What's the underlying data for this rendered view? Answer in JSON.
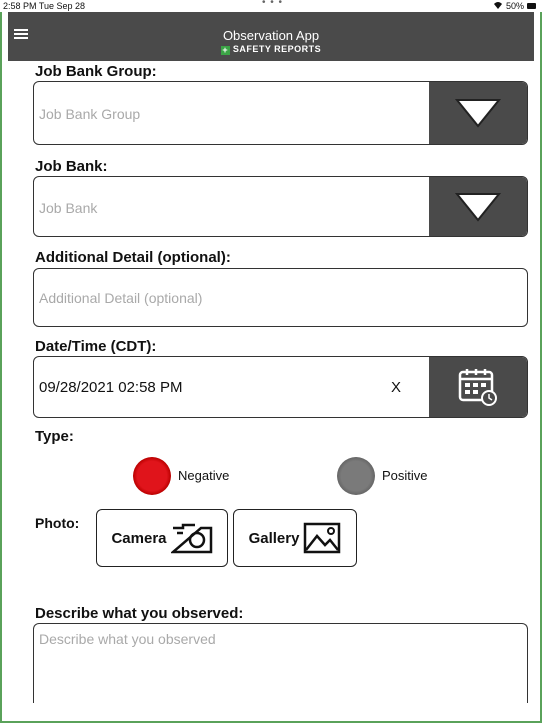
{
  "status": {
    "time": "2:58 PM  Tue Sep 28",
    "dots": "• • •",
    "battery": "50%"
  },
  "header": {
    "title": "Observation App",
    "brand": "SAFETY REPORTS"
  },
  "form": {
    "job_bank_group": {
      "label": "Job Bank Group:",
      "placeholder": "Job Bank Group"
    },
    "job_bank": {
      "label": "Job Bank:",
      "placeholder": "Job Bank"
    },
    "additional_detail": {
      "label": "Additional Detail (optional):",
      "placeholder": "Additional Detail (optional)"
    },
    "datetime": {
      "label": "Date/Time (CDT):",
      "value": "09/28/2021 02:58 PM",
      "clear": "X"
    },
    "type": {
      "label": "Type:",
      "negative": "Negative",
      "positive": "Positive",
      "selected": "Negative"
    },
    "photo": {
      "label": "Photo:",
      "camera": "Camera",
      "gallery": "Gallery"
    },
    "describe": {
      "label": "Describe what you observed:",
      "placeholder": "Describe what you observed"
    }
  },
  "colors": {
    "header": "#4a4a4a",
    "negative_radio": "#e0141b",
    "positive_radio": "#7a7a7a",
    "brand_green": "#3ba446",
    "frame": "#5aa25a"
  }
}
